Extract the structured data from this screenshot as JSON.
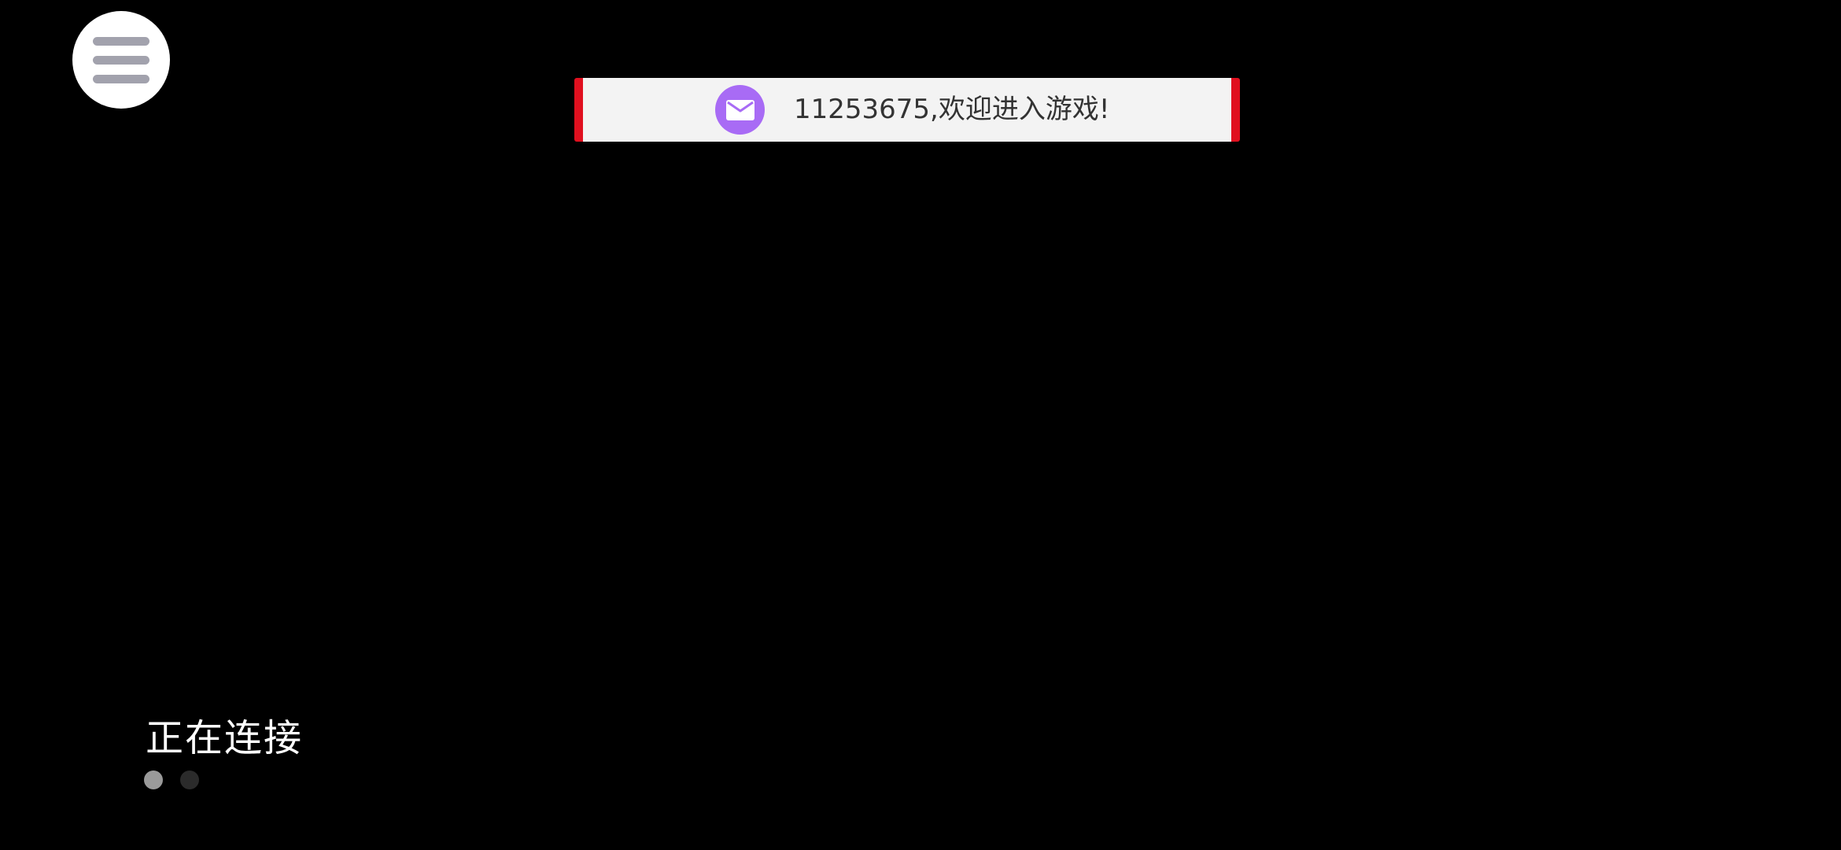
{
  "menu": {
    "icon": "hamburger-menu-icon"
  },
  "notice": {
    "icon": "mail-icon",
    "text": "11253675,欢迎进入游戏!",
    "accent_color": "#e0101f",
    "icon_color": "#a86bf5"
  },
  "status": {
    "text": "正在连接",
    "dots": [
      {
        "state": "active"
      },
      {
        "state": "inactive"
      }
    ]
  }
}
